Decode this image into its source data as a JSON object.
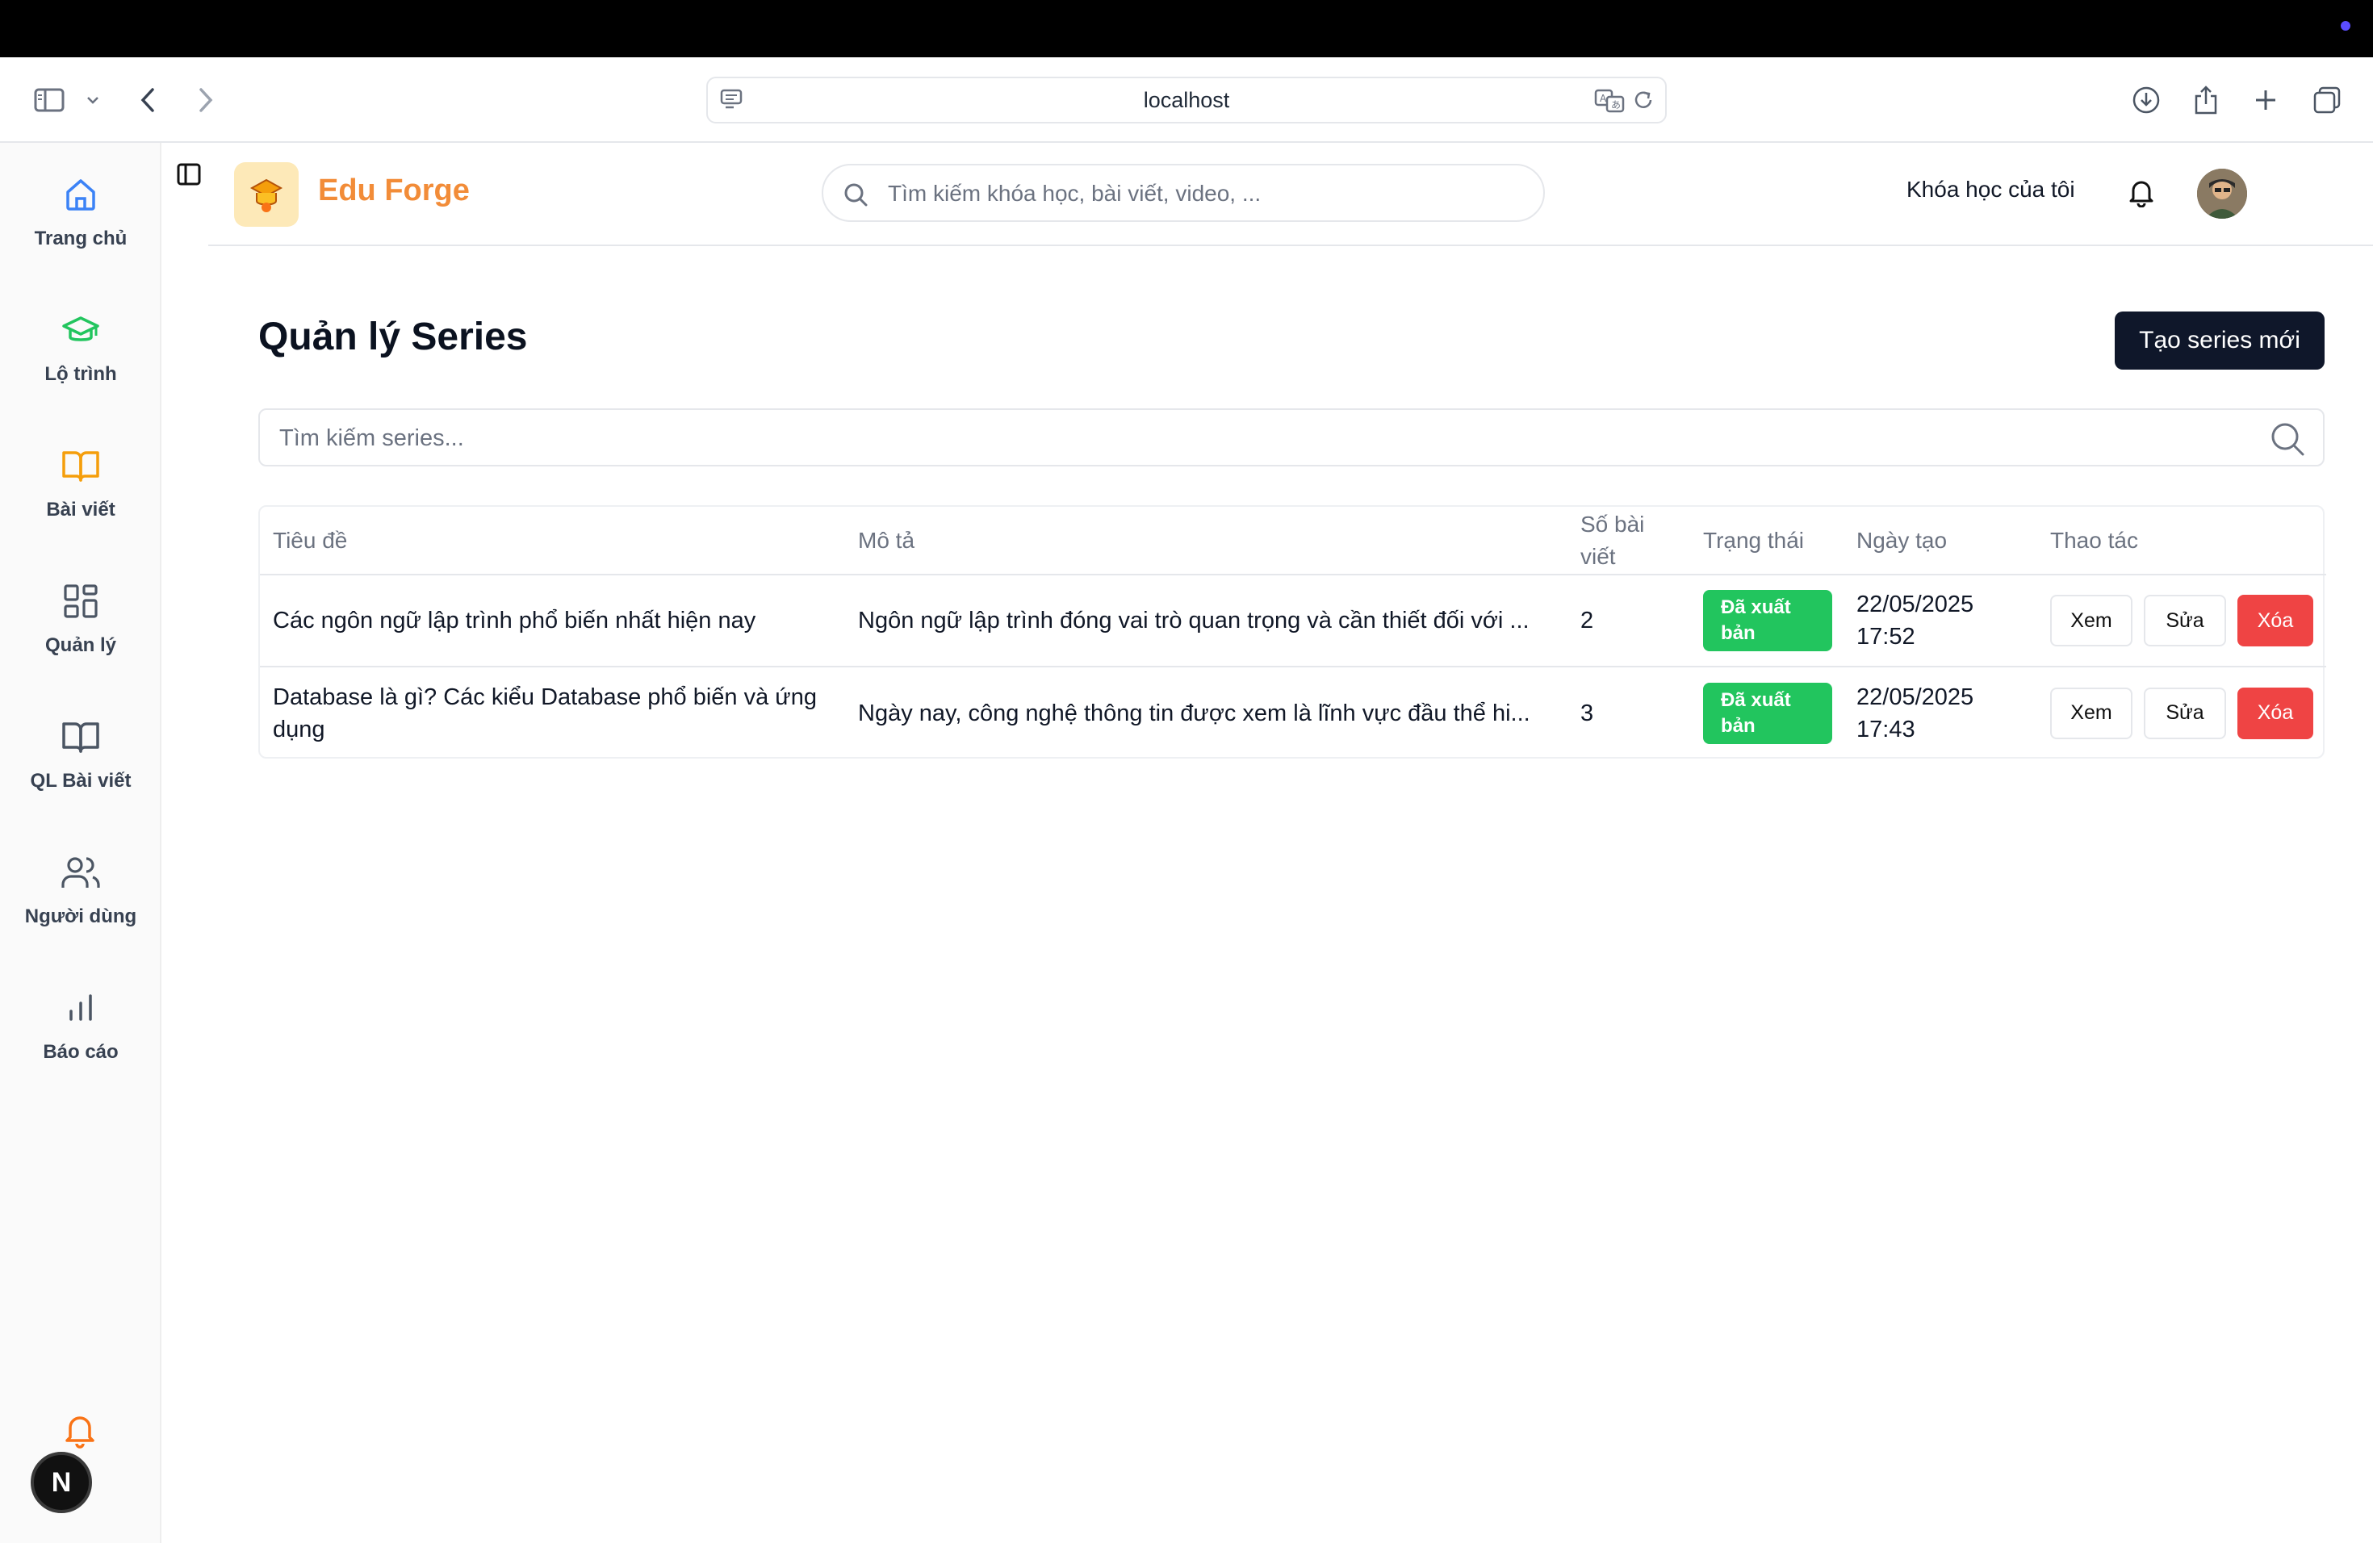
{
  "browser": {
    "url": "localhost"
  },
  "sidebar": {
    "items": [
      {
        "label": "Trang chủ",
        "icon": "home-icon"
      },
      {
        "label": "Lộ trình",
        "icon": "graduation-cap-icon"
      },
      {
        "label": "Bài viết",
        "icon": "book-open-icon"
      },
      {
        "label": "Quản lý",
        "icon": "grid-icon"
      },
      {
        "label": "QL Bài viết",
        "icon": "book-icon"
      },
      {
        "label": "Người dùng",
        "icon": "users-icon"
      },
      {
        "label": "Báo cáo",
        "icon": "bar-chart-icon"
      }
    ],
    "badge": "N"
  },
  "header": {
    "brand": "Edu Forge",
    "search_placeholder": "Tìm kiếm khóa học, bài viết, video, ...",
    "my_courses": "Khóa học của tôi"
  },
  "page": {
    "title": "Quản lý Series",
    "create_button": "Tạo series mới",
    "search_placeholder": "Tìm kiếm series..."
  },
  "table": {
    "headers": [
      "Tiêu đề",
      "Mô tả",
      "Số bài viết",
      "Trạng thái",
      "Ngày tạo",
      "Thao tác"
    ],
    "rows": [
      {
        "title": "Các ngôn ngữ lập trình phổ biến nhất hiện nay",
        "description": "Ngôn ngữ lập trình đóng vai trò quan trọng và cần thiết đối với ...",
        "count": "2",
        "status": "Đã xuất bản",
        "date": "22/05/2025",
        "time": "17:52"
      },
      {
        "title": "Database là gì? Các kiểu Database phổ biến và ứng dụng",
        "description": "Ngày nay, công nghệ thông tin được xem là lĩnh vực đầu thể hi...",
        "count": "3",
        "status": "Đã xuất bản",
        "date": "22/05/2025",
        "time": "17:43"
      }
    ],
    "actions": {
      "view": "Xem",
      "edit": "Sửa",
      "delete": "Xóa"
    }
  },
  "colors": {
    "brand": "#f28c38",
    "primary_button": "#0f172a",
    "status_published": "#22c55e",
    "danger": "#ef4444"
  }
}
